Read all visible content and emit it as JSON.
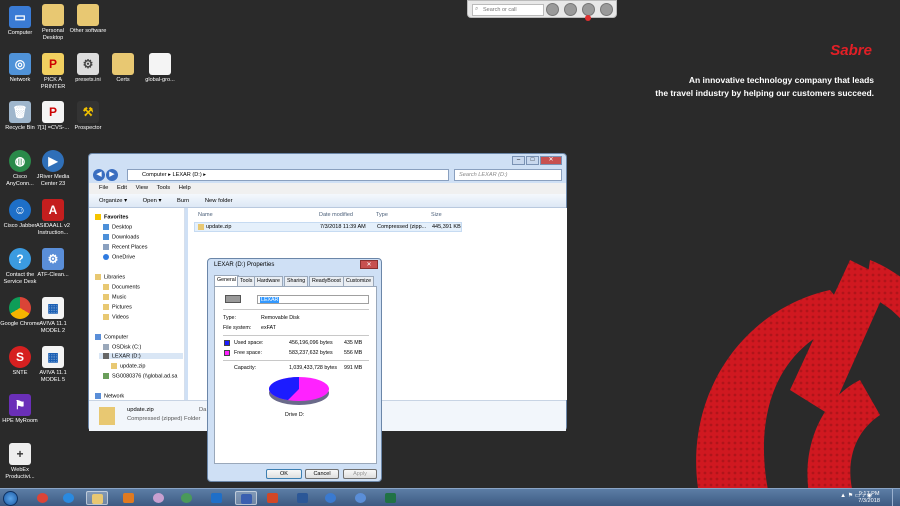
{
  "desktop": {
    "brand": "Sabre",
    "tagline_line1": "An innovative technology company that leads",
    "tagline_line2": "the travel industry by helping our customers succeed.",
    "icons": [
      {
        "label": "Computer"
      },
      {
        "label": "Personal Desktop"
      },
      {
        "label": "Other software"
      },
      {
        "label": "Network"
      },
      {
        "label": "PICK A PRINTER"
      },
      {
        "label": "presets.ini"
      },
      {
        "label": "Certs"
      },
      {
        "label": "global-gro..."
      },
      {
        "label": "Recycle Bin"
      },
      {
        "label": "7[1] =CVS-..."
      },
      {
        "label": "Prospector"
      },
      {
        "label": "Cisco AnyConn..."
      },
      {
        "label": "JRiver Media Center 23"
      },
      {
        "label": "Cisco Jabber"
      },
      {
        "label": "ASIDAALL v2 Instruction..."
      },
      {
        "label": "Contact the Service Desk"
      },
      {
        "label": "ATF-Clean..."
      },
      {
        "label": "Google Chrome"
      },
      {
        "label": "AVIVA 11.1 MODEL 2"
      },
      {
        "label": "SNTE"
      },
      {
        "label": "AVIVA 11.1 MODEL 5"
      },
      {
        "label": "HPE MyRoom"
      },
      {
        "label": "WebEx Productivi..."
      }
    ]
  },
  "callbar": {
    "placeholder": "Search or call"
  },
  "explorer": {
    "path_root": "Computer",
    "path_drive": "LEXAR (D:)",
    "search_placeholder": "Search LEXAR (D:)",
    "menu": [
      "File",
      "Edit",
      "View",
      "Tools",
      "Help"
    ],
    "toolbar": {
      "organize": "Organize ▾",
      "open": "Open ▾",
      "burn": "Burn",
      "new_folder": "New folder"
    },
    "nav": {
      "favorites": "Favorites",
      "desktop": "Desktop",
      "downloads": "Downloads",
      "recent": "Recent Places",
      "onedrive": "OneDrive",
      "libraries": "Libraries",
      "documents": "Documents",
      "music": "Music",
      "pictures": "Pictures",
      "videos": "Videos",
      "computer": "Computer",
      "osdisk": "OSDisk (C:)",
      "lexar": "LEXAR (D:)",
      "updatezip": "update.zip",
      "netshare": "SG0080376 (\\\\global.ad.sa",
      "network": "Network"
    },
    "columns": {
      "name": "Name",
      "date": "Date modified",
      "type": "Type",
      "size": "Size"
    },
    "file": {
      "name": "update.zip",
      "date": "7/3/2018 11:39 AM",
      "type": "Compressed (zipp...",
      "size": "445,391 KB"
    },
    "details": {
      "name": "update.zip",
      "type": "Compressed (zipped) Folder",
      "date_label": "Da"
    }
  },
  "properties": {
    "title": "LEXAR (D:) Properties",
    "tabs": [
      "General",
      "Tools",
      "Hardware",
      "Sharing",
      "ReadyBoost",
      "Customize"
    ],
    "name_value": "LEXAR",
    "type_label": "Type:",
    "type_value": "Removable Disk",
    "fs_label": "File system:",
    "fs_value": "exFAT",
    "used_label": "Used space:",
    "used_bytes": "456,196,096 bytes",
    "used_mb": "435 MB",
    "free_label": "Free space:",
    "free_bytes": "583,237,632 bytes",
    "free_mb": "556 MB",
    "cap_label": "Capacity:",
    "cap_bytes": "1,039,433,728 bytes",
    "cap_mb": "991 MB",
    "drive_label": "Drive D:",
    "used_fraction": 0.44,
    "colors": {
      "used": "#1c1cff",
      "free": "#ff22ff"
    },
    "buttons": {
      "ok": "OK",
      "cancel": "Cancel",
      "apply": "Apply"
    }
  },
  "taskbar": {
    "time": "9:17 PM",
    "date": "7/3/2018"
  }
}
